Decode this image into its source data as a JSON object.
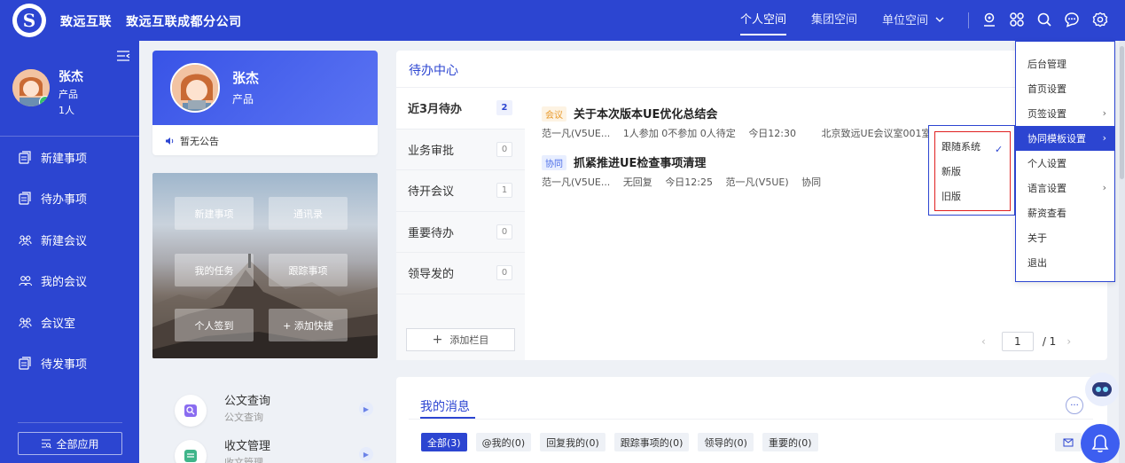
{
  "header": {
    "brand": "致远互联",
    "company": "致远互联成都分公司",
    "nav": [
      "个人空间",
      "集团空间",
      "单位空间"
    ]
  },
  "sidebar": {
    "user": {
      "name": "张杰",
      "role": "产品",
      "count": "1人"
    },
    "items": [
      {
        "label": "新建事项",
        "icon": "document-icon"
      },
      {
        "label": "待办事项",
        "icon": "document-icon"
      },
      {
        "label": "新建会议",
        "icon": "meeting-icon"
      },
      {
        "label": "我的会议",
        "icon": "people-icon"
      },
      {
        "label": "会议室",
        "icon": "meeting-icon"
      },
      {
        "label": "待发事项",
        "icon": "document-icon"
      }
    ],
    "all_apps": "全部应用"
  },
  "profile": {
    "name": "张杰",
    "role": "产品",
    "notice": "暂无公告"
  },
  "shortcuts": [
    "新建事项",
    "通讯录",
    "我的任务",
    "跟踪事项",
    "个人签到",
    "+ 添加快捷"
  ],
  "apps": [
    {
      "title": "公文查询",
      "sub": "公文查询"
    },
    {
      "title": "收文管理",
      "sub": "收文管理"
    }
  ],
  "todo": {
    "title": "待办中心",
    "tabs": [
      {
        "label": "近3月待办",
        "count": "2"
      },
      {
        "label": "业务审批",
        "count": "0"
      },
      {
        "label": "待开会议",
        "count": "1"
      },
      {
        "label": "重要待办",
        "count": "0"
      },
      {
        "label": "领导发的",
        "count": "0"
      }
    ],
    "add_column": "添加栏目",
    "items": [
      {
        "tag": "会议",
        "title": "关于本次版本UE优化总结会",
        "meta": [
          "范一凡(V5UE...",
          "1人参加 0不参加 0人待定",
          "今日12:30",
          "北京致远UE会议室001室"
        ]
      },
      {
        "tag": "协同",
        "title": "抓紧推进UE检查事项清理",
        "meta": [
          "范一凡(V5UE...",
          "无回复",
          "今日12:25",
          "范一凡(V5UE)",
          "协同"
        ]
      }
    ],
    "pager": {
      "current": "1",
      "total": "/ 1"
    }
  },
  "follow_menu": [
    "跟随系统",
    "新版",
    "旧版"
  ],
  "settings_menu": [
    {
      "label": "后台管理",
      "arrow": false
    },
    {
      "label": "首页设置",
      "arrow": false
    },
    {
      "label": "页签设置",
      "arrow": true
    },
    {
      "label": "协同模板设置",
      "arrow": true
    },
    {
      "label": "个人设置",
      "arrow": false
    },
    {
      "label": "语言设置",
      "arrow": true
    },
    {
      "label": "薪资查看",
      "arrow": false
    },
    {
      "label": "关于",
      "arrow": false
    },
    {
      "label": "退出",
      "arrow": false
    }
  ],
  "messages": {
    "title": "我的消息",
    "tabs": [
      "全部(3)",
      "@我的(0)",
      "回复我的(0)",
      "跟踪事项的(0)",
      "领导的(0)",
      "重要的(0)"
    ]
  },
  "colors": {
    "primary": "#2c45d1",
    "highlight_border": "#e02020"
  }
}
